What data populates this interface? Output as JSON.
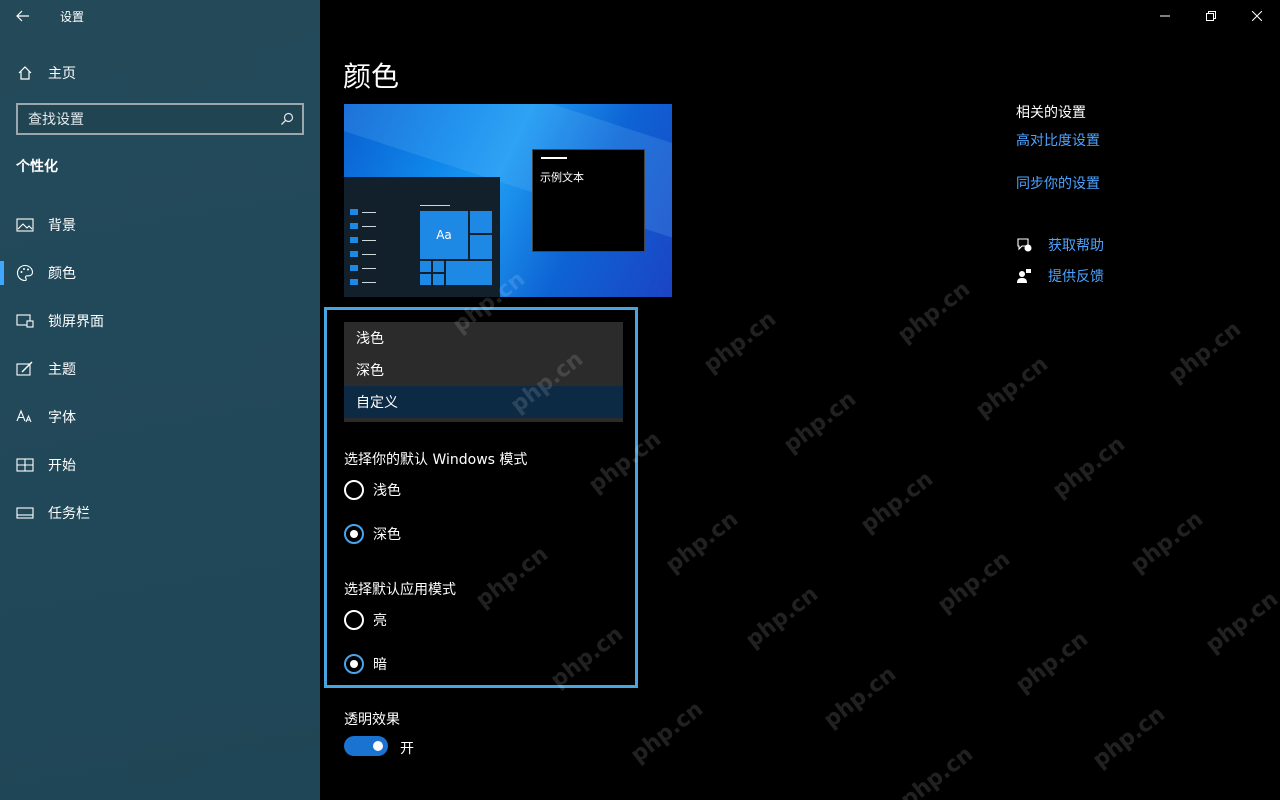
{
  "window": {
    "title": "设置",
    "controls": {
      "minimize": "minimize",
      "restore": "restore",
      "close": "close"
    }
  },
  "sidebar": {
    "home_label": "主页",
    "search_placeholder": "查找设置",
    "section": "个性化",
    "items": [
      {
        "label": "背景",
        "icon": "picture-icon"
      },
      {
        "label": "颜色",
        "icon": "palette-icon",
        "active": true
      },
      {
        "label": "锁屏界面",
        "icon": "lock-screen-icon"
      },
      {
        "label": "主题",
        "icon": "theme-brush-icon"
      },
      {
        "label": "字体",
        "icon": "font-icon"
      },
      {
        "label": "开始",
        "icon": "start-icon"
      },
      {
        "label": "任务栏",
        "icon": "taskbar-icon"
      }
    ]
  },
  "main": {
    "title": "颜色",
    "preview": {
      "sample_text": "示例文本",
      "tile_text": "Aa"
    },
    "color_dropdown": {
      "options": [
        "浅色",
        "深色",
        "自定义"
      ],
      "selected": "自定义"
    },
    "windows_mode": {
      "label": "选择你的默认 Windows 模式",
      "options": [
        {
          "label": "浅色",
          "checked": false
        },
        {
          "label": "深色",
          "checked": true
        }
      ]
    },
    "app_mode": {
      "label": "选择默认应用模式",
      "options": [
        {
          "label": "亮",
          "checked": false
        },
        {
          "label": "暗",
          "checked": true
        }
      ]
    },
    "transparency": {
      "label": "透明效果",
      "state_label": "开",
      "on": true
    }
  },
  "related": {
    "heading": "相关的设置",
    "links": [
      "高对比度设置",
      "同步你的设置"
    ],
    "help": {
      "get_help": "获取帮助",
      "feedback": "提供反馈"
    }
  },
  "watermark": "php.cn",
  "colors": {
    "sidebar_bg": "#22495a",
    "accent": "#1a73d1",
    "link": "#4da3ff",
    "highlight_border": "#47a5e2"
  }
}
